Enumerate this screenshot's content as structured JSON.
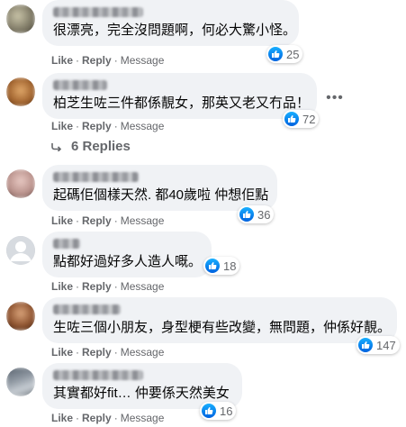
{
  "actions": {
    "like": "Like",
    "reply": "Reply",
    "sep": "·",
    "message": "Message"
  },
  "comments": [
    {
      "text": "很漂亮，完全沒問題啊，何必大驚小怪。",
      "likes": "25"
    },
    {
      "text": "柏芝生咗三件都係靚女，那英又老又冇品！",
      "likes": "72"
    },
    {
      "text": "起碼佢個樣天然. 都40歲啦 仲想佢點",
      "likes": "36"
    },
    {
      "text": "點都好過好多人造人嘅。",
      "likes": "18"
    },
    {
      "text": "生咗三個小朋友，身型梗有些改變，無問題，仲係好靚。",
      "likes": "147"
    },
    {
      "text": "其實都好fit… 仲要係天然美女",
      "likes": "16"
    }
  ],
  "replies_label": "6 Replies",
  "more_icon": "more-horizontal-icon",
  "colors": {
    "bubble": "#f0f2f5",
    "meta": "#65676b",
    "like_blue": "#1877f2"
  }
}
